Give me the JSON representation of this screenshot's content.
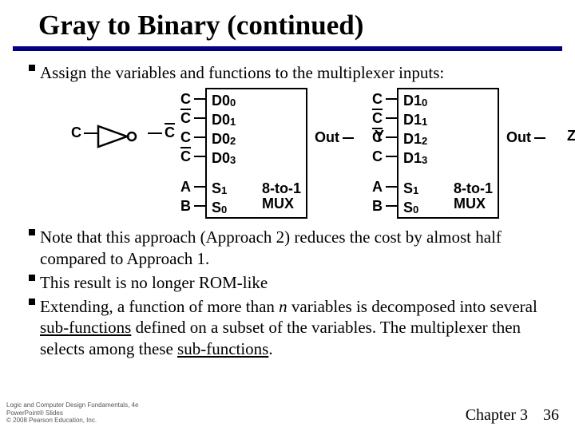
{
  "title": "Gray to Binary (continued)",
  "bullets": {
    "b1": "Assign the variables and functions to the multiplexer inputs:",
    "b2": "Note that this approach (Approach 2) reduces the cost by almost half compared to Approach 1.",
    "b3": "This result is no longer ROM-like",
    "b4_a": "Extending, a function of more than ",
    "b4_n": "n",
    "b4_b": " variables is decomposed into several ",
    "b4_sub": "sub-functions",
    "b4_c": " defined on a subset of the variables. The multiplexer then selects among these ",
    "b4_sub2": "sub-functions",
    "b4_d": "."
  },
  "sig": {
    "C": "C",
    "A": "A",
    "B": "B"
  },
  "mux": {
    "left": {
      "d0": {
        "pre": "D0",
        "sub": "0"
      },
      "d1": {
        "pre": "D0",
        "sub": "1"
      },
      "d2": {
        "pre": "D0",
        "sub": "2"
      },
      "d3": {
        "pre": "D0",
        "sub": "3"
      },
      "s1": {
        "pre": "S",
        "sub": "1"
      },
      "s0": {
        "pre": "S",
        "sub": "0"
      },
      "out": "Out",
      "label_a": "8-to-1",
      "label_b": "MUX",
      "yout": "Y"
    },
    "right": {
      "d0": {
        "pre": "D1",
        "sub": "0"
      },
      "d1": {
        "pre": "D1",
        "sub": "1"
      },
      "d2": {
        "pre": "D1",
        "sub": "2"
      },
      "d3": {
        "pre": "D1",
        "sub": "3"
      },
      "s1": {
        "pre": "S",
        "sub": "1"
      },
      "s0": {
        "pre": "S",
        "sub": "0"
      },
      "out": "Out",
      "label_a": "8-to-1",
      "label_b": "MUX",
      "zout": "Z"
    }
  },
  "footer": {
    "copy1": "Logic and Computer Design Fundamentals, 4e",
    "copy2": "PowerPoint® Slides",
    "copy3": "© 2008 Pearson Education, Inc.",
    "chapter": "Chapter 3",
    "page": "36"
  }
}
